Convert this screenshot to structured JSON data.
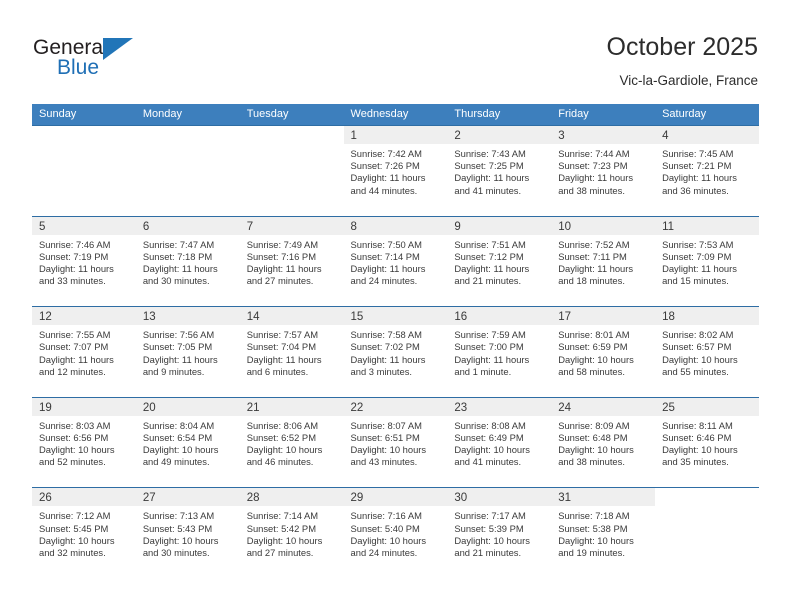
{
  "brand": {
    "name_part1": "General",
    "name_part2": "Blue",
    "accent_color": "#2175b8"
  },
  "header": {
    "month_title": "October 2025",
    "location": "Vic-la-Gardiole, France"
  },
  "calendar": {
    "header_color": "#3d7fbd",
    "separator_color": "#2e6da4",
    "daynum_band_color": "#efefef",
    "day_names": [
      "Sunday",
      "Monday",
      "Tuesday",
      "Wednesday",
      "Thursday",
      "Friday",
      "Saturday"
    ],
    "weeks": [
      [
        {
          "day": "",
          "sunrise": "",
          "sunset": "",
          "daylight1": "",
          "daylight2": ""
        },
        {
          "day": "",
          "sunrise": "",
          "sunset": "",
          "daylight1": "",
          "daylight2": ""
        },
        {
          "day": "",
          "sunrise": "",
          "sunset": "",
          "daylight1": "",
          "daylight2": ""
        },
        {
          "day": "1",
          "sunrise": "Sunrise: 7:42 AM",
          "sunset": "Sunset: 7:26 PM",
          "daylight1": "Daylight: 11 hours",
          "daylight2": "and 44 minutes."
        },
        {
          "day": "2",
          "sunrise": "Sunrise: 7:43 AM",
          "sunset": "Sunset: 7:25 PM",
          "daylight1": "Daylight: 11 hours",
          "daylight2": "and 41 minutes."
        },
        {
          "day": "3",
          "sunrise": "Sunrise: 7:44 AM",
          "sunset": "Sunset: 7:23 PM",
          "daylight1": "Daylight: 11 hours",
          "daylight2": "and 38 minutes."
        },
        {
          "day": "4",
          "sunrise": "Sunrise: 7:45 AM",
          "sunset": "Sunset: 7:21 PM",
          "daylight1": "Daylight: 11 hours",
          "daylight2": "and 36 minutes."
        }
      ],
      [
        {
          "day": "5",
          "sunrise": "Sunrise: 7:46 AM",
          "sunset": "Sunset: 7:19 PM",
          "daylight1": "Daylight: 11 hours",
          "daylight2": "and 33 minutes."
        },
        {
          "day": "6",
          "sunrise": "Sunrise: 7:47 AM",
          "sunset": "Sunset: 7:18 PM",
          "daylight1": "Daylight: 11 hours",
          "daylight2": "and 30 minutes."
        },
        {
          "day": "7",
          "sunrise": "Sunrise: 7:49 AM",
          "sunset": "Sunset: 7:16 PM",
          "daylight1": "Daylight: 11 hours",
          "daylight2": "and 27 minutes."
        },
        {
          "day": "8",
          "sunrise": "Sunrise: 7:50 AM",
          "sunset": "Sunset: 7:14 PM",
          "daylight1": "Daylight: 11 hours",
          "daylight2": "and 24 minutes."
        },
        {
          "day": "9",
          "sunrise": "Sunrise: 7:51 AM",
          "sunset": "Sunset: 7:12 PM",
          "daylight1": "Daylight: 11 hours",
          "daylight2": "and 21 minutes."
        },
        {
          "day": "10",
          "sunrise": "Sunrise: 7:52 AM",
          "sunset": "Sunset: 7:11 PM",
          "daylight1": "Daylight: 11 hours",
          "daylight2": "and 18 minutes."
        },
        {
          "day": "11",
          "sunrise": "Sunrise: 7:53 AM",
          "sunset": "Sunset: 7:09 PM",
          "daylight1": "Daylight: 11 hours",
          "daylight2": "and 15 minutes."
        }
      ],
      [
        {
          "day": "12",
          "sunrise": "Sunrise: 7:55 AM",
          "sunset": "Sunset: 7:07 PM",
          "daylight1": "Daylight: 11 hours",
          "daylight2": "and 12 minutes."
        },
        {
          "day": "13",
          "sunrise": "Sunrise: 7:56 AM",
          "sunset": "Sunset: 7:05 PM",
          "daylight1": "Daylight: 11 hours",
          "daylight2": "and 9 minutes."
        },
        {
          "day": "14",
          "sunrise": "Sunrise: 7:57 AM",
          "sunset": "Sunset: 7:04 PM",
          "daylight1": "Daylight: 11 hours",
          "daylight2": "and 6 minutes."
        },
        {
          "day": "15",
          "sunrise": "Sunrise: 7:58 AM",
          "sunset": "Sunset: 7:02 PM",
          "daylight1": "Daylight: 11 hours",
          "daylight2": "and 3 minutes."
        },
        {
          "day": "16",
          "sunrise": "Sunrise: 7:59 AM",
          "sunset": "Sunset: 7:00 PM",
          "daylight1": "Daylight: 11 hours",
          "daylight2": "and 1 minute."
        },
        {
          "day": "17",
          "sunrise": "Sunrise: 8:01 AM",
          "sunset": "Sunset: 6:59 PM",
          "daylight1": "Daylight: 10 hours",
          "daylight2": "and 58 minutes."
        },
        {
          "day": "18",
          "sunrise": "Sunrise: 8:02 AM",
          "sunset": "Sunset: 6:57 PM",
          "daylight1": "Daylight: 10 hours",
          "daylight2": "and 55 minutes."
        }
      ],
      [
        {
          "day": "19",
          "sunrise": "Sunrise: 8:03 AM",
          "sunset": "Sunset: 6:56 PM",
          "daylight1": "Daylight: 10 hours",
          "daylight2": "and 52 minutes."
        },
        {
          "day": "20",
          "sunrise": "Sunrise: 8:04 AM",
          "sunset": "Sunset: 6:54 PM",
          "daylight1": "Daylight: 10 hours",
          "daylight2": "and 49 minutes."
        },
        {
          "day": "21",
          "sunrise": "Sunrise: 8:06 AM",
          "sunset": "Sunset: 6:52 PM",
          "daylight1": "Daylight: 10 hours",
          "daylight2": "and 46 minutes."
        },
        {
          "day": "22",
          "sunrise": "Sunrise: 8:07 AM",
          "sunset": "Sunset: 6:51 PM",
          "daylight1": "Daylight: 10 hours",
          "daylight2": "and 43 minutes."
        },
        {
          "day": "23",
          "sunrise": "Sunrise: 8:08 AM",
          "sunset": "Sunset: 6:49 PM",
          "daylight1": "Daylight: 10 hours",
          "daylight2": "and 41 minutes."
        },
        {
          "day": "24",
          "sunrise": "Sunrise: 8:09 AM",
          "sunset": "Sunset: 6:48 PM",
          "daylight1": "Daylight: 10 hours",
          "daylight2": "and 38 minutes."
        },
        {
          "day": "25",
          "sunrise": "Sunrise: 8:11 AM",
          "sunset": "Sunset: 6:46 PM",
          "daylight1": "Daylight: 10 hours",
          "daylight2": "and 35 minutes."
        }
      ],
      [
        {
          "day": "26",
          "sunrise": "Sunrise: 7:12 AM",
          "sunset": "Sunset: 5:45 PM",
          "daylight1": "Daylight: 10 hours",
          "daylight2": "and 32 minutes."
        },
        {
          "day": "27",
          "sunrise": "Sunrise: 7:13 AM",
          "sunset": "Sunset: 5:43 PM",
          "daylight1": "Daylight: 10 hours",
          "daylight2": "and 30 minutes."
        },
        {
          "day": "28",
          "sunrise": "Sunrise: 7:14 AM",
          "sunset": "Sunset: 5:42 PM",
          "daylight1": "Daylight: 10 hours",
          "daylight2": "and 27 minutes."
        },
        {
          "day": "29",
          "sunrise": "Sunrise: 7:16 AM",
          "sunset": "Sunset: 5:40 PM",
          "daylight1": "Daylight: 10 hours",
          "daylight2": "and 24 minutes."
        },
        {
          "day": "30",
          "sunrise": "Sunrise: 7:17 AM",
          "sunset": "Sunset: 5:39 PM",
          "daylight1": "Daylight: 10 hours",
          "daylight2": "and 21 minutes."
        },
        {
          "day": "31",
          "sunrise": "Sunrise: 7:18 AM",
          "sunset": "Sunset: 5:38 PM",
          "daylight1": "Daylight: 10 hours",
          "daylight2": "and 19 minutes."
        },
        {
          "day": "",
          "sunrise": "",
          "sunset": "",
          "daylight1": "",
          "daylight2": ""
        }
      ]
    ]
  }
}
